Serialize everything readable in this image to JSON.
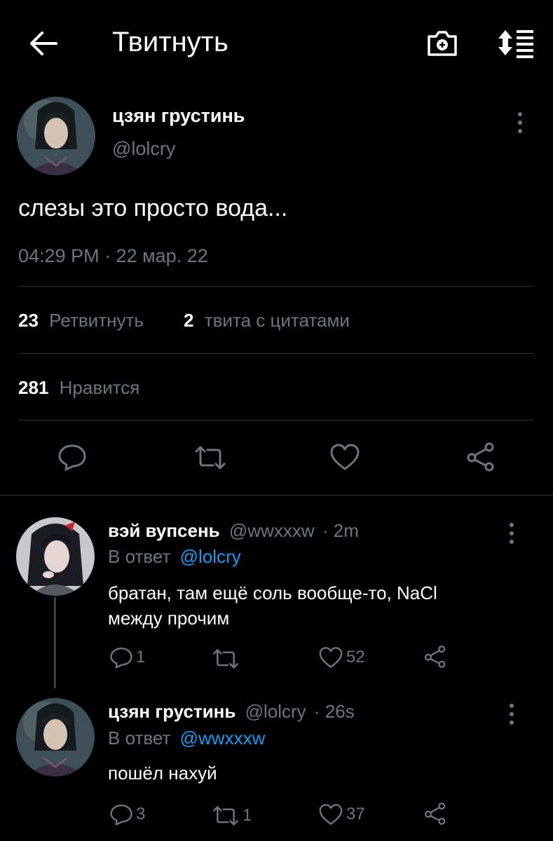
{
  "header": {
    "title": "Твитнуть",
    "back_icon": "arrow-left-icon",
    "camera_icon": "camera-add-icon",
    "sort_icon": "sort-icon"
  },
  "main_tweet": {
    "name": "цзян грустинь",
    "handle": "@lolcry",
    "text": "слезы это просто вода...",
    "timestamp": "04:29 PM · 22 мар. 22",
    "retweets_count": "23",
    "retweets_label": "Ретвитнуть",
    "quotes_count": "2",
    "quotes_label": "твита с цитатами",
    "likes_count": "281",
    "likes_label": "Нравится"
  },
  "replies": [
    {
      "name": "вэй вупсень",
      "handle": "@wwxxxw",
      "time": "· 2m",
      "reply_prefix": "В ответ",
      "reply_to": "@lolcry",
      "text_line1": "братан, там ещё соль вообще-то, NaCl",
      "text_line2": "между прочим",
      "reply_count": "1",
      "retweet_count": "",
      "like_count": "52"
    },
    {
      "name": "цзян грустинь",
      "handle": "@lolcry",
      "time": "· 26s",
      "reply_prefix": "В ответ",
      "reply_to": "@wwxxxw",
      "text_line1": "пошёл нахуй",
      "reply_count": "3",
      "retweet_count": "1",
      "like_count": "37"
    }
  ],
  "colors": {
    "background": "#000000",
    "text": "#e7e9ea",
    "muted": "#6e767d",
    "link": "#1d9bf0",
    "divider": "#2f3336"
  }
}
